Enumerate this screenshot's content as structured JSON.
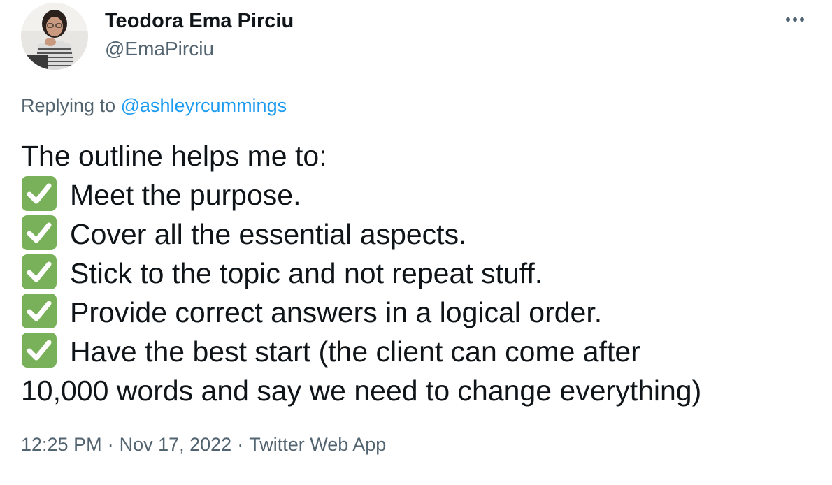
{
  "author": {
    "display_name": "Teodora Ema Pirciu",
    "handle": "@EmaPirciu",
    "avatar_icon": "profile-photo"
  },
  "reply": {
    "prefix": "Replying to",
    "to_handle": "@ashleyrcummings"
  },
  "tweet": {
    "lines": [
      {
        "check": false,
        "text": "The outline helps me to:"
      },
      {
        "check": true,
        "text": "Meet the purpose."
      },
      {
        "check": true,
        "text": "Cover all the essential aspects."
      },
      {
        "check": true,
        "text": "Stick to the topic and not repeat stuff."
      },
      {
        "check": true,
        "text": "Provide correct answers in a logical order."
      },
      {
        "check": true,
        "text": "Have the best start (the client can come after"
      },
      {
        "check": false,
        "text": "10,000 words and say we need to change everything)"
      }
    ],
    "check_icon": "white-check-mark-emoji"
  },
  "meta": {
    "time": "12:25 PM",
    "date": "Nov 17, 2022",
    "source": "Twitter Web App",
    "separator": "·"
  },
  "more_icon": "more-horizontal-icon",
  "colors": {
    "text_primary": "#0f1419",
    "text_secondary": "#536471",
    "link": "#1d9bf0",
    "check_green": "#78b159"
  }
}
